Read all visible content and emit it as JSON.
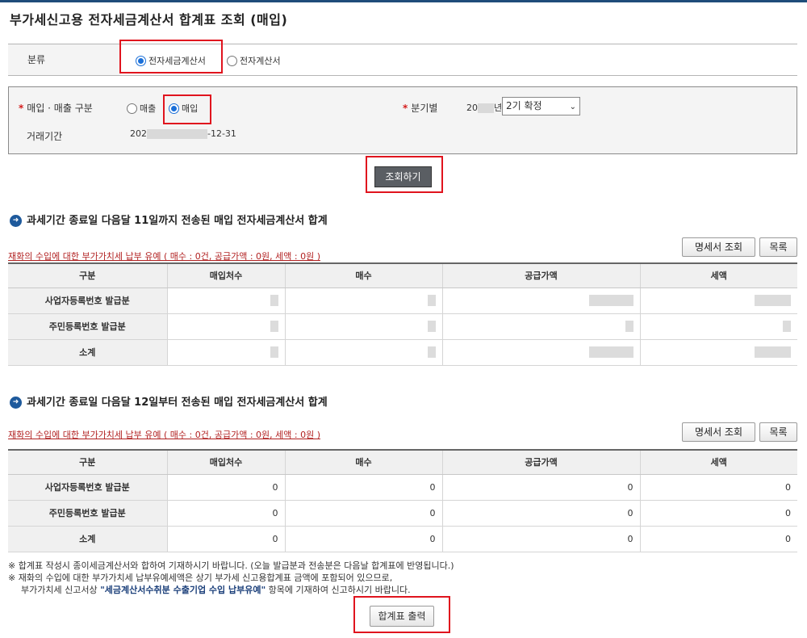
{
  "title": "부가세신고용 전자세금계산서 합계표 조회 (매입)",
  "category": {
    "label": "분류",
    "options": [
      "전자세금계산서",
      "전자계산서"
    ],
    "selected": 0
  },
  "conditions": {
    "type_label": "매입 · 매출 구분",
    "type_options": [
      "매출",
      "매입"
    ],
    "quarter_label": "분기별",
    "year_prefix": "20",
    "year_suffix": "년",
    "quarter_value": "2기 확정",
    "period_label": "거래기간",
    "period_start": "202",
    "period_end": "-12-31"
  },
  "search_button": "조회하기",
  "sections": [
    {
      "title": "과세기간 종료일 다음달 11일까지 전송된 매입 전자세금계산서 합계",
      "link": "재화의 수입에 대한 부가가치세 납부 유예 ( 매수 : 0건, 공급가액 : 0원, 세액 : 0원 )",
      "btn_detail": "명세서 조회",
      "btn_list": "목록",
      "headers": [
        "구분",
        "매입처수",
        "매수",
        "공급가액",
        "세액"
      ],
      "rows": [
        {
          "label": "사업자등록번호 발급분",
          "values": [
            "",
            "",
            "",
            ""
          ]
        },
        {
          "label": "주민등록번호 발급분",
          "values": [
            "",
            "",
            "",
            ""
          ]
        },
        {
          "label": "소계",
          "values": [
            "",
            "",
            "",
            ""
          ]
        }
      ]
    },
    {
      "title": "과세기간 종료일 다음달 12일부터 전송된 매입 전자세금계산서 합계",
      "link": "재화의 수입에 대한 부가가치세 납부 유예 ( 매수 : 0건, 공급가액 : 0원, 세액 : 0원 )",
      "btn_detail": "명세서 조회",
      "btn_list": "목록",
      "headers": [
        "구분",
        "매입처수",
        "매수",
        "공급가액",
        "세액"
      ],
      "rows": [
        {
          "label": "사업자등록번호 발급분",
          "values": [
            "0",
            "0",
            "0",
            "0"
          ]
        },
        {
          "label": "주민등록번호 발급분",
          "values": [
            "0",
            "0",
            "0",
            "0"
          ]
        },
        {
          "label": "소계",
          "values": [
            "0",
            "0",
            "0",
            "0"
          ]
        }
      ]
    }
  ],
  "notes": {
    "line1": "※ 합계표 작성시 종이세금계산서와 합하여 기재하시기 바랍니다. (오늘 발급분과 전송분은 다음날 합계표에 반영됩니다.)",
    "line2": "※ 재화의 수입에 대한 부가가치세 납부유예세액은 상기 부가세 신고용합계표 금액에 포함되어 있으므로,",
    "line3_pre": "부가가치세 신고서상 ",
    "line3_bold": "\"세금계산서수취분 수출기업 수입 납부유예\"",
    "line3_post": " 항목에 기재하여 신고하시기 바랍니다."
  },
  "print_button": "합계표 출력"
}
